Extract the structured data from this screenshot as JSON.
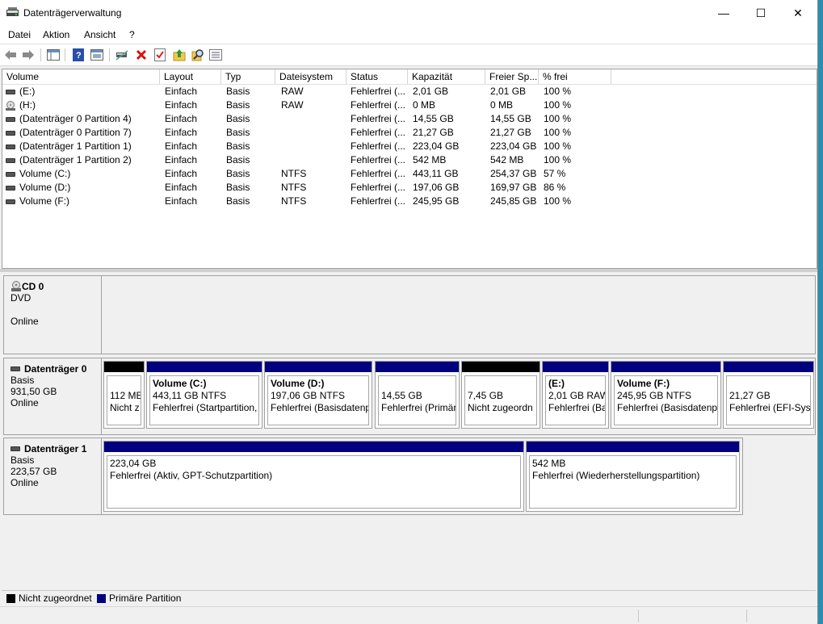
{
  "window": {
    "title": "Datenträgerverwaltung",
    "minimize": "—",
    "maximize": "☐",
    "close": "✕"
  },
  "menu": [
    "Datei",
    "Aktion",
    "Ansicht",
    "?"
  ],
  "list": {
    "columns": [
      "Volume",
      "Layout",
      "Typ",
      "Dateisystem",
      "Status",
      "Kapazität",
      "Freier Sp...",
      "% frei"
    ],
    "rows": [
      {
        "icon": "drive-icon",
        "volume": "(E:)",
        "layout": "Einfach",
        "typ": "Basis",
        "fs": "RAW",
        "status": "Fehlerfrei (...",
        "cap": "2,01 GB",
        "free": "2,01 GB",
        "pct": "100 %"
      },
      {
        "icon": "cd-drive-icon",
        "volume": "(H:)",
        "layout": "Einfach",
        "typ": "Basis",
        "fs": "RAW",
        "status": "Fehlerfrei (...",
        "cap": "0 MB",
        "free": "0 MB",
        "pct": "100 %"
      },
      {
        "icon": "drive-icon",
        "volume": "(Datenträger 0 Partition 4)",
        "layout": "Einfach",
        "typ": "Basis",
        "fs": "",
        "status": "Fehlerfrei (...",
        "cap": "14,55 GB",
        "free": "14,55 GB",
        "pct": "100 %"
      },
      {
        "icon": "drive-icon",
        "volume": "(Datenträger 0 Partition 7)",
        "layout": "Einfach",
        "typ": "Basis",
        "fs": "",
        "status": "Fehlerfrei (...",
        "cap": "21,27 GB",
        "free": "21,27 GB",
        "pct": "100 %"
      },
      {
        "icon": "drive-icon",
        "volume": "(Datenträger 1 Partition 1)",
        "layout": "Einfach",
        "typ": "Basis",
        "fs": "",
        "status": "Fehlerfrei (...",
        "cap": "223,04 GB",
        "free": "223,04 GB",
        "pct": "100 %"
      },
      {
        "icon": "drive-icon",
        "volume": "(Datenträger 1 Partition 2)",
        "layout": "Einfach",
        "typ": "Basis",
        "fs": "",
        "status": "Fehlerfrei (...",
        "cap": "542 MB",
        "free": "542 MB",
        "pct": "100 %"
      },
      {
        "icon": "drive-icon",
        "volume": "Volume (C:)",
        "layout": "Einfach",
        "typ": "Basis",
        "fs": "NTFS",
        "status": "Fehlerfrei (...",
        "cap": "443,11 GB",
        "free": "254,37 GB",
        "pct": "57 %"
      },
      {
        "icon": "drive-icon",
        "volume": "Volume (D:)",
        "layout": "Einfach",
        "typ": "Basis",
        "fs": "NTFS",
        "status": "Fehlerfrei (...",
        "cap": "197,06 GB",
        "free": "169,97 GB",
        "pct": "86 %"
      },
      {
        "icon": "drive-icon",
        "volume": "Volume (F:)",
        "layout": "Einfach",
        "typ": "Basis",
        "fs": "NTFS",
        "status": "Fehlerfrei (...",
        "cap": "245,95 GB",
        "free": "245,85 GB",
        "pct": "100 %"
      }
    ]
  },
  "disks": {
    "cd0": {
      "name": "CD 0",
      "type": "DVD",
      "state": "Online"
    },
    "disk0": {
      "name": "Datenträger 0",
      "type": "Basis",
      "size": "931,50 GB",
      "state": "Online",
      "partitions": [
        {
          "kind": "unalloc",
          "title": "",
          "l1": "112 ME",
          "l2": "Nicht z"
        },
        {
          "kind": "primary",
          "title": "Volume  (C:)",
          "l1": "443,11 GB NTFS",
          "l2": "Fehlerfrei (Startpartition,"
        },
        {
          "kind": "primary",
          "title": "Volume  (D:)",
          "l1": "197,06 GB NTFS",
          "l2": "Fehlerfrei (Basisdatenpa"
        },
        {
          "kind": "primary",
          "title": "",
          "l1": "14,55 GB",
          "l2": "Fehlerfrei (Primär"
        },
        {
          "kind": "unalloc",
          "title": "",
          "l1": "7,45 GB",
          "l2": "Nicht zugeordn"
        },
        {
          "kind": "primary",
          "title": "(E:)",
          "l1": "2,01 GB RAW",
          "l2": "Fehlerfrei (Ba"
        },
        {
          "kind": "primary",
          "title": "Volume  (F:)",
          "l1": "245,95 GB NTFS",
          "l2": "Fehlerfrei (Basisdatenpa"
        },
        {
          "kind": "primary",
          "title": "",
          "l1": "21,27 GB",
          "l2": "Fehlerfrei (EFI-Syste"
        }
      ]
    },
    "disk1": {
      "name": "Datenträger 1",
      "type": "Basis",
      "size": "223,57 GB",
      "state": "Online",
      "partitions": [
        {
          "kind": "primary",
          "l1": "223,04 GB",
          "l2": "Fehlerfrei (Aktiv, GPT-Schutzpartition)"
        },
        {
          "kind": "primary",
          "l1": "542 MB",
          "l2": "Fehlerfrei (Wiederherstellungspartition)"
        }
      ]
    }
  },
  "legend": {
    "unalloc": "Nicht zugeordnet",
    "primary": "Primäre Partition"
  },
  "colors": {
    "primary": "#00007f",
    "unalloc": "#000000"
  }
}
